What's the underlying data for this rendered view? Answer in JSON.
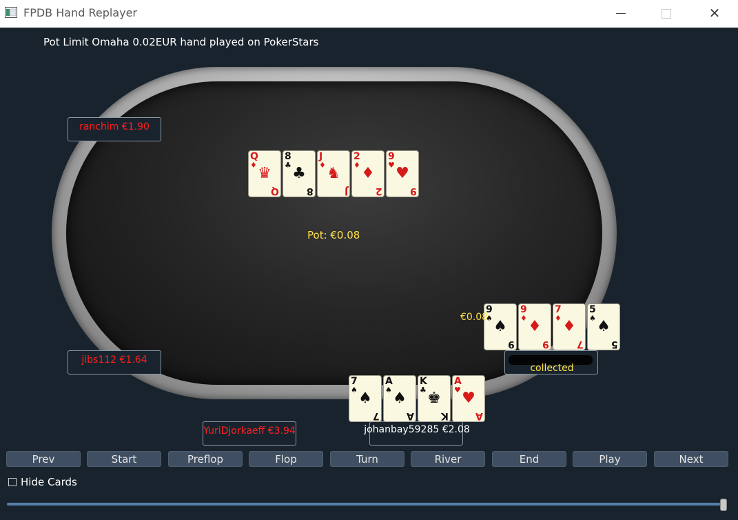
{
  "window": {
    "title": "FPDB Hand Replayer",
    "minimize_icon": "minimize-icon",
    "maximize_icon": "maximize-icon",
    "close_icon": "close-icon",
    "close_glyph": "✕"
  },
  "hand_description": "Pot Limit Omaha 0.02EUR hand played on PokerStars",
  "board": {
    "cards": [
      {
        "rank": "Q",
        "suit": "♦",
        "color": "red",
        "face": "♛"
      },
      {
        "rank": "8",
        "suit": "♣",
        "color": "black",
        "face": "♣"
      },
      {
        "rank": "J",
        "suit": "♦",
        "color": "red",
        "face": "♞"
      },
      {
        "rank": "2",
        "suit": "♦",
        "color": "red",
        "face": "♦"
      },
      {
        "rank": "9",
        "suit": "♥",
        "color": "red",
        "face": "♥"
      }
    ]
  },
  "pot": "Pot: €0.08",
  "players": {
    "ranchim": "ranchim €1.90",
    "jibs112": "jibs112 €1.64",
    "yuri": "YuriDjorkaeff €3.94",
    "hero": "johanbay59285 €2.08",
    "winner_status": "collected",
    "winner_bet": "€0.08"
  },
  "winner_cards": [
    {
      "rank": "9",
      "suit": "♠",
      "color": "black",
      "face": "♠"
    },
    {
      "rank": "9",
      "suit": "♦",
      "color": "red",
      "face": "♦"
    },
    {
      "rank": "7",
      "suit": "♦",
      "color": "red",
      "face": "♦"
    },
    {
      "rank": "5",
      "suit": "♠",
      "color": "black",
      "face": "♠"
    }
  ],
  "hero_cards": [
    {
      "rank": "7",
      "suit": "♠",
      "color": "black",
      "face": "♠"
    },
    {
      "rank": "A",
      "suit": "♠",
      "color": "black",
      "face": "♠"
    },
    {
      "rank": "K",
      "suit": "♣",
      "color": "black",
      "face": "♚"
    },
    {
      "rank": "A",
      "suit": "♥",
      "color": "red",
      "face": "♥"
    }
  ],
  "controls": {
    "prev": "Prev",
    "start": "Start",
    "preflop": "Preflop",
    "flop": "Flop",
    "turn": "Turn",
    "river": "River",
    "end": "End",
    "play": "Play",
    "next": "Next"
  },
  "hide_cards_label": "Hide Cards",
  "hide_cards_checked": false,
  "replay_progress": 1.0,
  "colors": {
    "background": "#19232d",
    "button": "#3f4f61",
    "player_text": "#ff2020",
    "pot_text": "#ffe14a",
    "slider": "#5680ab"
  }
}
